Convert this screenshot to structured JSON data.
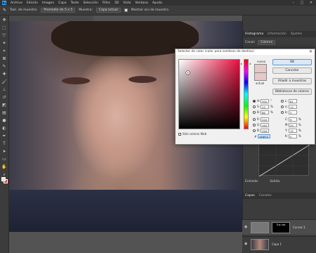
{
  "menubar": {
    "logo": "Ps",
    "items": [
      "Archivo",
      "Edición",
      "Imagen",
      "Capa",
      "Texto",
      "Selección",
      "Filtro",
      "3D",
      "Vista",
      "Ventana",
      "Ayuda"
    ]
  },
  "optionsbar": {
    "size_label": "Tam. de muestra:",
    "size_value": "Promedio de 5 x 5",
    "sample_label": "Muestra:",
    "sample_value": "Capa actual",
    "ring_label": "Mostrar aro de muestra"
  },
  "doc_tab": {
    "title": ""
  },
  "right_panel": {
    "tabs": [
      "Histograma",
      "Información",
      "Ajustes"
    ],
    "channel_label": "Canal:",
    "channel_value": "Colores",
    "curves_in": "Entrada:",
    "curves_out": "Salida:",
    "layers_tabs": [
      "Capas",
      "Canales"
    ],
    "layers": [
      {
        "name": "Curvas 1",
        "mask_text": "Tus not"
      },
      {
        "name": "Capa 1",
        "mask_text": ""
      }
    ]
  },
  "dialog": {
    "title": "Selector de color (color para sombras de destino)",
    "new_label": "nuevo",
    "current_label": "actual",
    "buttons": {
      "ok": "OK",
      "cancel": "Cancelar",
      "add_swatches": "Añadir a muestras",
      "libraries": "Bibliotecas de colores"
    },
    "web_only": "Sólo colores Web",
    "new_color": "#e6c8c8",
    "fields_left": [
      {
        "label": "H:",
        "value": "352",
        "unit": "°",
        "selected": true
      },
      {
        "label": "S:",
        "value": "13",
        "unit": "%",
        "selected": false
      },
      {
        "label": "B:",
        "value": "86",
        "unit": "%",
        "selected": false
      },
      {
        "label": "R:",
        "value": "220",
        "unit": "",
        "selected": false
      },
      {
        "label": "G:",
        "value": "192",
        "unit": "",
        "selected": false
      },
      {
        "label": "B:",
        "value": "194",
        "unit": "",
        "selected": false
      }
    ],
    "fields_right": [
      {
        "label": "L:",
        "value": "81",
        "unit": ""
      },
      {
        "label": "a:",
        "value": "13",
        "unit": ""
      },
      {
        "label": "b:",
        "value": "3",
        "unit": ""
      },
      {
        "label": "C:",
        "value": "9",
        "unit": "%"
      },
      {
        "label": "M:",
        "value": "25",
        "unit": "%"
      },
      {
        "label": "Y:",
        "value": "15",
        "unit": "%"
      },
      {
        "label": "K:",
        "value": "0",
        "unit": "%"
      }
    ],
    "hex_label": "#",
    "hex_value": "dcbfc2"
  }
}
